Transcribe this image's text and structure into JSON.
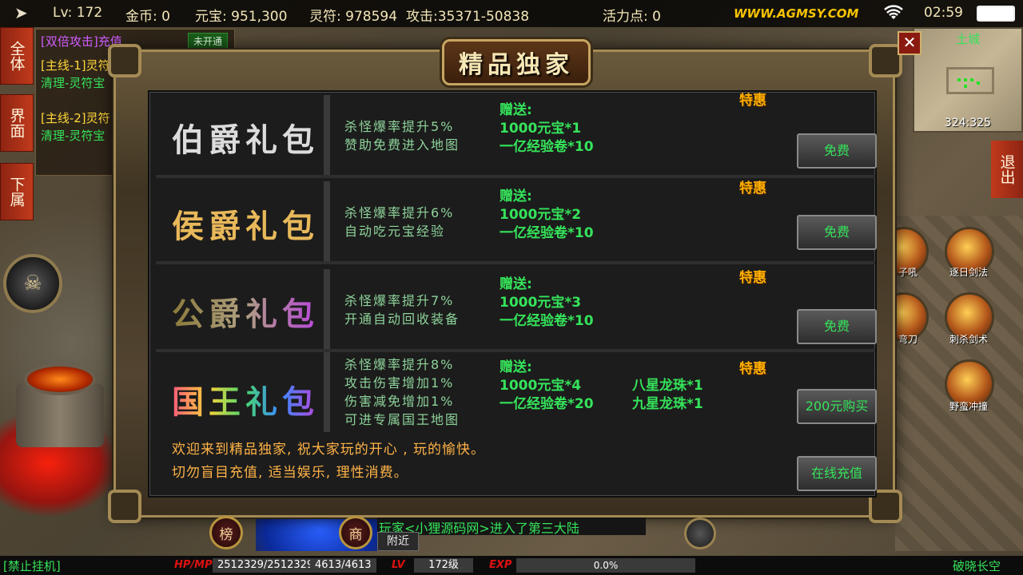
{
  "status_bar": {
    "level": "Lv: 172",
    "gold": "金币: 0",
    "yuanbao": "元宝: 951,300",
    "lingfu": "灵符: 978594",
    "attack": "攻击:35371-50838",
    "vitality": "活力点: 0",
    "site": "WWW.AGMSY.COM",
    "clock": "02:59"
  },
  "side_tabs": [
    "全体",
    "界面",
    "下属"
  ],
  "quests": {
    "line1": "[双倍攻击]充值",
    "line1_badge": "未开通",
    "line2": "[主线-1]灵符",
    "line3": "清理-灵符宝",
    "line4": "[主线-2]灵符",
    "line5": "清理-灵符宝"
  },
  "minimap": {
    "map_name": "土城",
    "coords": "324:325"
  },
  "exit_label": "退出",
  "skills": {
    "s1": "子吼",
    "s2": "逐日剑法",
    "s3": "弯刀",
    "s4": "刺杀剑术",
    "s5": "野蛮冲撞"
  },
  "dialog": {
    "title": "精品独家",
    "close": "✕",
    "packages": [
      {
        "name": "伯爵礼包",
        "effects": [
          "杀怪爆率提升5%",
          "赞助免费进入地图"
        ],
        "gift_title": "赠送:",
        "gifts": [
          "1000元宝*1",
          "一亿经验卷*10"
        ],
        "extra_gifts": [],
        "tag": "特惠",
        "button": "免费"
      },
      {
        "name": "侯爵礼包",
        "effects": [
          "杀怪爆率提升6%",
          "自动吃元宝经验"
        ],
        "gift_title": "赠送:",
        "gifts": [
          "1000元宝*2",
          "一亿经验卷*10"
        ],
        "extra_gifts": [],
        "tag": "特惠",
        "button": "免费"
      },
      {
        "name": "公爵礼包",
        "effects": [
          "杀怪爆率提升7%",
          "开通自动回收装备"
        ],
        "gift_title": "赠送:",
        "gifts": [
          "1000元宝*3",
          "一亿经验卷*10"
        ],
        "extra_gifts": [],
        "tag": "特惠",
        "button": "免费"
      },
      {
        "name": "国王礼包",
        "effects": [
          "杀怪爆率提升8%",
          "攻击伤害增加1%",
          "伤害减免增加1%",
          "可进专属国王地图"
        ],
        "gift_title": "赠送:",
        "gifts": [
          "1000元宝*4",
          "一亿经验卷*20"
        ],
        "extra_gifts": [
          "八星龙珠*1",
          "九星龙珠*1"
        ],
        "tag": "特惠",
        "button": "200元购买"
      }
    ],
    "footer_line1": "欢迎来到精品独家, 祝大家玩的开心 , 玩的愉快。",
    "footer_line2": "切勿盲目充值, 适当娱乐, 理性消费。",
    "recharge_button": "在线充值"
  },
  "chat": {
    "message": "玩家<小狸源码网>进入了第三大陆",
    "nearby": "附近",
    "rank_btn": "榜",
    "shop_btn": "商"
  },
  "bottom_bar": {
    "auto_hang": "[禁止挂机]",
    "hpmp_label": "HP/MP",
    "hp": "2512329/2512329",
    "mp": "4613/4613",
    "lv_label": "LV",
    "level": "172级",
    "exp_label": "EXP",
    "exp_percent": "0.0%",
    "server": "破晓长空"
  },
  "colors": {
    "name_gold": "#e8b85a",
    "name_white": "#dcdcdc",
    "highlight_green": "#35e35a",
    "tag_orange": "#ffb000",
    "footer_orange": "#ffb347"
  }
}
